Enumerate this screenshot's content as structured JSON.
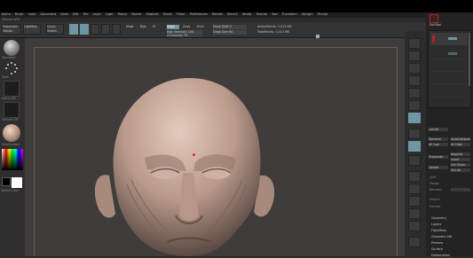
{
  "app": {
    "menu_items": [
      "Alpha",
      "Brush",
      "Color",
      "Document",
      "Draw",
      "Edit",
      "File",
      "Layer",
      "Light",
      "Macro",
      "Marker",
      "Material",
      "Movie",
      "Picker",
      "Preferences",
      "Render",
      "Stencil",
      "Stroke",
      "Texture",
      "Tool",
      "Transform",
      "Zplugin",
      "Zscript"
    ],
    "window_title_text": "ZBrush 4R6"
  },
  "shelf": {
    "projection_master_label": "Projection Master",
    "lightbox_label": "LightBox",
    "quick_sketch_label": "Quick Sketch",
    "mrgb_label": "Mrgb",
    "rgb_label": "Rgb",
    "m_label": "M",
    "zadd_label": "Zadd",
    "zsub_label": "Zsub",
    "zcut_label": "Zcut",
    "focal_shift_label": "Focal Shift 0",
    "draw_size_label": "Draw Size 64",
    "rgb_intensity_label": "Rgb Intensity 100",
    "z_intensity_label": "Z Intensity 25",
    "active_points_label": "ActivePoints: 1,013 Mil",
    "total_points_label": "TotalPoints: 1,013 Mil"
  },
  "left_tray": {
    "standard_label": "Standard",
    "dots_label": "Dots",
    "alpha_off_label": "Alpha Off",
    "texture_off_label": "Texture Off",
    "skin_label": "SkinShade4",
    "switch_color_label": "SwitchColor"
  },
  "right_panel": {
    "subtool_label": "SubTool",
    "list_all_label": "List All",
    "rename_label": "Rename",
    "auto_collapse_label": "AutoCollapse",
    "all_low_label": "All Low",
    "all_high_label": "All High",
    "duplicate_label": "Duplicate",
    "append_label": "Append",
    "insert_label": "Insert",
    "del_other_label": "Del Other",
    "delete_label": "Delete",
    "del_all_label": "Del All",
    "split_label": "Split",
    "merge_label": "Merge",
    "remesh_label": "Remesh",
    "project_label": "Project",
    "extract_label": "Extract",
    "geometry_label": "Geometry",
    "layers_label": "Layers",
    "fibermesh_label": "FiberMesh",
    "geometry_hd_label": "Geometry HD",
    "preview_label": "Preview",
    "surface_label": "Surface",
    "deformation_label": "Deformation"
  },
  "viewport": {
    "marker_color": "#e0253a"
  },
  "colors": {
    "accent": "#6f97a3",
    "active_red": "#b8202c",
    "skin": "#c9ab98"
  }
}
